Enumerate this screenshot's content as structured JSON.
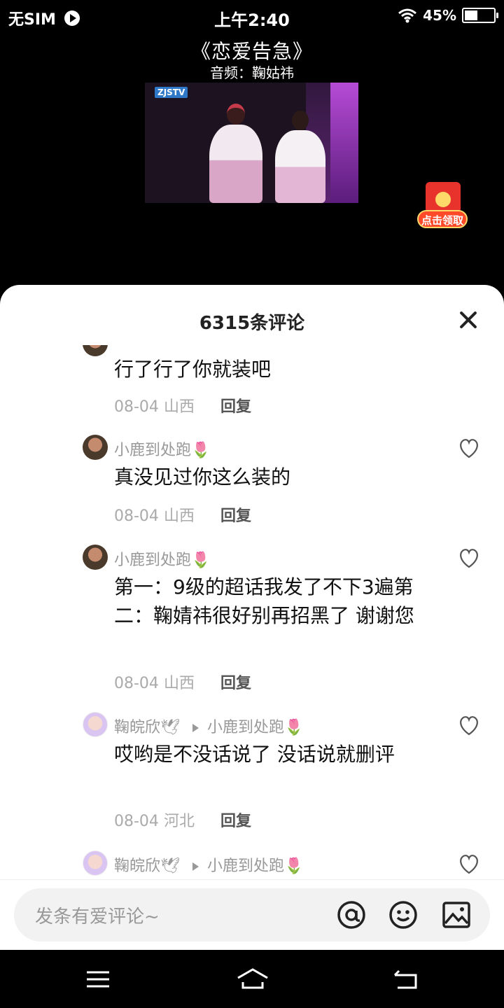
{
  "status_bar": {
    "carrier": "无SIM",
    "time": "上午2:40",
    "battery": "45%",
    "battery_level": 0.45
  },
  "video": {
    "title": "《恋爱告急》",
    "subtitle": "音频：鞠姑祎",
    "redpacket_label": "点击领取"
  },
  "sheet": {
    "title": "6315条评论",
    "close_icon": "close-icon"
  },
  "comments": [
    {
      "user": "",
      "text": "行了行了你就装吧",
      "date": "08-04",
      "location": "山西",
      "reply": "回复"
    },
    {
      "user": "小鹿到处跑🌷",
      "text": "真没见过你这么装的",
      "date": "08-04",
      "location": "山西",
      "reply": "回复"
    },
    {
      "user": "小鹿到处跑🌷",
      "text": "第一：9级的超话我发了不下3遍第二：鞠婧祎很好别再招黑了 谢谢您",
      "date": "08-04",
      "location": "山西",
      "reply": "回复"
    },
    {
      "user": "鞠皖欣🕊",
      "reply_to": "小鹿到处跑🌷",
      "text": "哎哟是不没话说了 没话说就删评",
      "date": "08-04",
      "location": "河北",
      "reply": "回复"
    },
    {
      "user": "鞠皖欣🕊",
      "reply_to": "小鹿到处跑🌷"
    }
  ],
  "input": {
    "placeholder": "发条有爱评论~",
    "icons": [
      "at-icon",
      "emoji-icon",
      "image-icon"
    ]
  },
  "nav": {
    "icons": [
      "menu-icon",
      "home-icon",
      "back-icon"
    ]
  }
}
